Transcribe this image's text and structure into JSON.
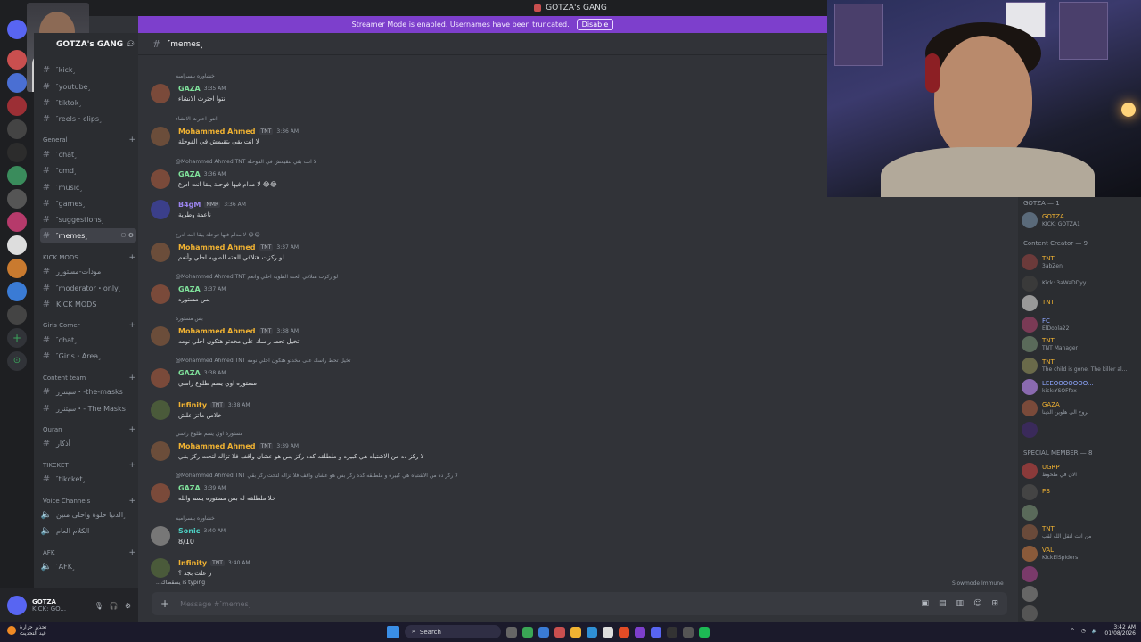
{
  "window": {
    "title": "GOTZA's GANG"
  },
  "banner": {
    "text": "Streamer Mode is enabled. Usernames have been truncated.",
    "disable_label": "Disable"
  },
  "server": {
    "name": "GOTZA's GANG"
  },
  "sidebar": {
    "channels_top": [
      {
        "label": "˹kick˼"
      },
      {
        "label": "˹youtube˼"
      },
      {
        "label": "˹tiktok˼"
      },
      {
        "label": "˹reels・clips˼"
      }
    ],
    "category_general": "General",
    "general_channels": [
      {
        "label": "˹chat˼"
      },
      {
        "label": "˹cmd˼"
      },
      {
        "label": "˹music˼"
      },
      {
        "label": "˹games˼"
      },
      {
        "label": "˹suggestions˼"
      },
      {
        "label": "˹memes˼"
      }
    ],
    "category_kick": "KICK MODS",
    "kick_channels": [
      {
        "label": "مودات-مستورر"
      },
      {
        "label": "˹moderator・only˼"
      },
      {
        "label": "KICK MODS"
      }
    ],
    "category_girls": "Girls Corner",
    "girls_channels": [
      {
        "label": "˹chat˼"
      },
      {
        "label": "˹Girls・Area˼"
      }
    ],
    "category_content": "Content team",
    "content_channels": [
      {
        "label": "سيتنزر・-the-masks"
      },
      {
        "label": "سيتنزر・- The Masks"
      }
    ],
    "category_quran": "Quran",
    "quran_channels": [
      {
        "label": "أذكار"
      }
    ],
    "category_ticket": "TIKCKET",
    "ticket_channels": [
      {
        "label": "˹tikcket˼"
      }
    ],
    "category_voice": "Voice Channels",
    "voice_channels": [
      {
        "label": "الدنيا حلوة واحلى منين˼"
      },
      {
        "label": "الكلام العام"
      }
    ],
    "category_afk": "AFK",
    "afk_channels": [
      {
        "label": "˹AFK˼"
      }
    ]
  },
  "user_panel": {
    "name": "GOTZA",
    "status": "KICK: GO..."
  },
  "chat": {
    "channel_name": "˹memes˼",
    "composer_placeholder": "Message #˹memes˼",
    "typing": "...يسقطاك is typing",
    "slowmode": "Slowmode Immune",
    "messages": [
      {
        "reply": "خشاوره بيسرامبه",
        "name": "GAZA",
        "time": "3:35 AM",
        "text": "انتوا احترث الانشاء"
      },
      {
        "reply": "انتوا احترث الانشاء",
        "name": "Mohammed Ahmed",
        "tag": "TNT",
        "time": "3:36 AM",
        "text": "لا انت بقي بتقيمش في الفوحلة"
      },
      {
        "reply": "@Mohammed Ahmed  TNT  لا انت بقي بتقيمش في الفوحلة",
        "name": "GAZA",
        "time": "3:36 AM",
        "text": "لا مدام فيها فوحلة يبقا انت ادرع 😂😂"
      },
      {
        "name": "B4gM",
        "tag": "NMR",
        "time": "3:36 AM",
        "text": "ناعمة وطرية"
      },
      {
        "reply": "لا مدام فيها فوحلة يبقا انت ادرع 😂😂",
        "name": "Mohammed Ahmed",
        "tag": "TNT",
        "time": "3:37 AM",
        "text": "لو ركزت هتلاقي الحته الطويه احلي وأنعم"
      },
      {
        "reply": "@Mohammed Ahmed  TNT  لو ركزت هتلاقي الحته الطويه احلي وانعم",
        "name": "GAZA",
        "time": "3:37 AM",
        "text": "بس مستوره"
      },
      {
        "reply": "بس مستوره",
        "name": "Mohammed Ahmed",
        "tag": "TNT",
        "time": "3:38 AM",
        "text": "تخيل تحط راسك على مخدتو هتكون احلي نومه"
      },
      {
        "reply": "@Mohammed Ahmed  TNT  تخيل تحط راسك على مخدتو هتكون احلي نومه",
        "name": "GAZA",
        "time": "3:38 AM",
        "text": "مستوره اوي يسم طلوع راسي"
      },
      {
        "name": "Infinity",
        "tag": "TNT",
        "time": "3:38 AM",
        "text": "خلاص ماتز علش"
      },
      {
        "reply": "مستوره اوي يسم طلوع راسي",
        "name": "Mohammed Ahmed",
        "tag": "TNT",
        "time": "3:39 AM",
        "text": "لا ركز ده من الاشتباه هي كبيره و ملطلقه كده ركز بس هو عشان واقف فلا تزاله لتحت ركز بقي"
      },
      {
        "reply": "@Mohammed Ahmed  TNT  لا ركز ده من الاشتباه هي كبيره و ملطلقه كده ركز بس هو عشان واقف فلا تزاله لتحت ركز بقي",
        "name": "GAZA",
        "time": "3:39 AM",
        "text": "خلا ملطلقه له بس مستوره يسم والله"
      },
      {
        "reply": "خشاوره بيسرامبه",
        "name": "Sonic",
        "time": "3:40 AM",
        "text": "8/10"
      },
      {
        "name": "Infinity",
        "tag": "TNT",
        "time": "3:40 AM",
        "text": "ز علت بجد ؟"
      }
    ]
  },
  "members": {
    "cat_gotza": "GOTZA — 1",
    "gotza": {
      "name": "GOTZA",
      "tag": "TNT",
      "sub": "KICK: GOTZA1"
    },
    "cat_creator": "Content Creator — 9",
    "creators": [
      {
        "name": "TNT",
        "sub": "3abZen"
      },
      {
        "name": "",
        "sub": "Kick: 3aWaDDyy"
      },
      {
        "name": "TNT",
        "sub": ""
      },
      {
        "name": "FC",
        "sub": "ElDoola22"
      },
      {
        "name": "TNT",
        "sub": "TNT Manager"
      },
      {
        "name": "TNT",
        "sub": "The child is gone. The killer al..."
      },
      {
        "name": "LEEOOOOOOO...",
        "sub": "kick:YSOFfex"
      },
      {
        "name": "GAZA",
        "sub": "بروح الى هلوين الدينا"
      },
      {
        "name": "",
        "sub": ""
      }
    ],
    "cat_special": "SPECIAL MEMBER — 8",
    "specials": [
      {
        "name": "UGRP",
        "sub": "الان في ملحوظ"
      },
      {
        "name": "PB",
        "sub": ""
      },
      {
        "name": "",
        "sub": ""
      },
      {
        "name": "TNT",
        "sub": "من انت لتقل الله لقب"
      },
      {
        "name": "VAL",
        "sub": "KickElSpiders"
      },
      {
        "name": "",
        "sub": ""
      },
      {
        "name": "",
        "sub": ""
      },
      {
        "name": "",
        "sub": ""
      }
    ]
  },
  "taskbar": {
    "weather_line1": "تحذير حرارة",
    "weather_line2": "قيد التحديث",
    "search_label": "Search",
    "time": "3:42 AM",
    "date": "01/08/2026"
  },
  "colors": {
    "accent": "#7d3fcc",
    "brand": "#5865f2",
    "name_gold": "#f0b232"
  }
}
